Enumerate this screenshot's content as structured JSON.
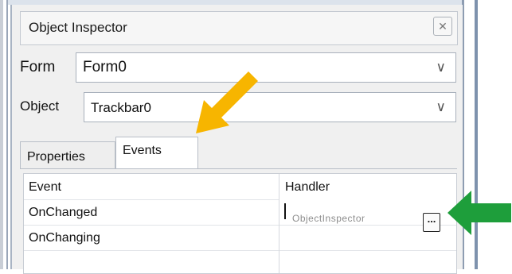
{
  "window": {
    "title": "Object Inspector",
    "close_icon": "close-icon"
  },
  "form_row": {
    "label": "Form",
    "value": "Form0"
  },
  "object_row": {
    "label": "Object",
    "value": "Trackbar0"
  },
  "tabs": [
    {
      "label": "Properties",
      "active": false
    },
    {
      "label": "Events",
      "active": true
    }
  ],
  "grid": {
    "headers": [
      "Event",
      "Handler"
    ],
    "rows": [
      {
        "event": "OnChanged",
        "handler": "",
        "handler_ghost_text": "ObjectInspector",
        "has_button": true,
        "button_label": "..."
      },
      {
        "event": "OnChanging",
        "handler": ""
      }
    ]
  },
  "annotations": {
    "orange_arrow_color": "#f7b500",
    "green_arrow_color": "#1e9e3b"
  }
}
